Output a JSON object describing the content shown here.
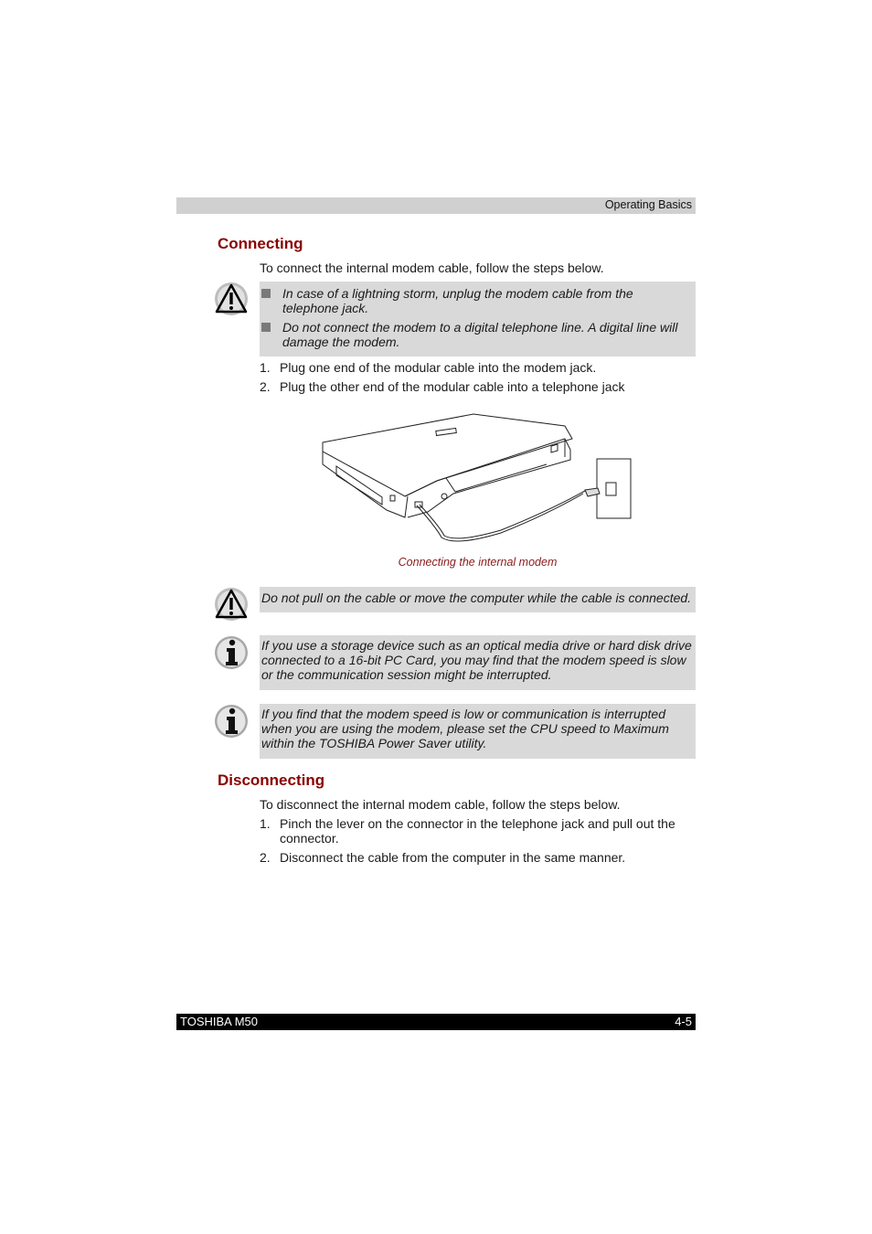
{
  "header": {
    "section": "Operating Basics"
  },
  "connecting": {
    "title": "Connecting",
    "intro": "To connect the internal modem cable, follow the steps below.",
    "caution": {
      "icon": "warning-icon",
      "bullets": [
        "In case of a lightning storm, unplug the modem cable from the telephone jack.",
        "Do not connect the modem to a digital telephone line. A digital line will damage the modem."
      ]
    },
    "steps": [
      {
        "num": "1.",
        "text": "Plug one end of the modular cable into the modem jack."
      },
      {
        "num": "2.",
        "text": "Plug the other end of the modular cable into a telephone jack"
      }
    ],
    "figure": {
      "caption": "Connecting the internal modem"
    }
  },
  "notes": [
    {
      "icon": "warning-icon",
      "text": "Do not pull on the cable or move the computer while the cable is connected."
    },
    {
      "icon": "info-icon",
      "text": "If you use a storage device such as an optical media drive or hard disk drive connected to a 16-bit PC Card, you may find that the modem speed is slow or the communication session might be interrupted."
    },
    {
      "icon": "info-icon",
      "text": "If you find that the modem speed is low or communication is interrupted when you are using the modem, please set the CPU speed to Maximum within the TOSHIBA Power Saver utility."
    }
  ],
  "disconnecting": {
    "title": "Disconnecting",
    "intro": "To disconnect the internal modem cable, follow the steps below.",
    "steps": [
      {
        "num": "1.",
        "text": "Pinch the lever on the connector in the telephone jack and pull out the connector."
      },
      {
        "num": "2.",
        "text": "Disconnect the cable from the computer in the same manner."
      }
    ]
  },
  "footer": {
    "product": "TOSHIBA M50",
    "page": "4-5"
  },
  "colors": {
    "heading": "#8b0000",
    "note_bg": "#d9d9d9",
    "header_bg": "#d0d0d0",
    "footer_bg": "#000000"
  }
}
